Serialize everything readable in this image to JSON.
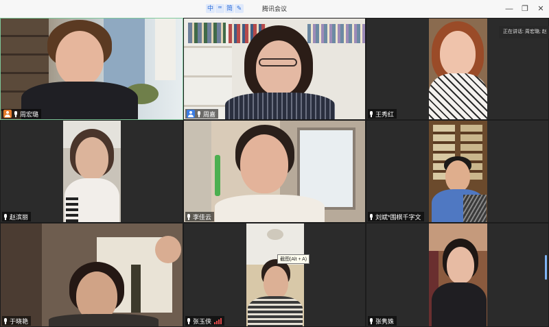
{
  "window": {
    "title": "腾讯会议",
    "ime_indicators": [
      "中",
      "ꟹ",
      "简",
      "✎"
    ],
    "controls": [
      "minimize-icon",
      "restore-icon",
      "close-icon"
    ]
  },
  "speaking_banner": "正在讲话: 周宏璐; 赵",
  "screenshot_tooltip": "截图(Alt + A)",
  "participants": [
    {
      "name": "周宏璐",
      "icon": "host-icon",
      "mic": "mic-icon"
    },
    {
      "name": "周嘉",
      "icon": "cohost-icon",
      "mic": "mic-icon"
    },
    {
      "name": "王秀红",
      "mic": "mic-icon"
    },
    {
      "name": "赵滨丽",
      "mic": "mic-icon"
    },
    {
      "name": "李佳云",
      "mic": "mic-icon"
    },
    {
      "name": "刘斌*围棋千字文",
      "mic": "mic-icon"
    },
    {
      "name": "于晓艳",
      "mic": "mic-icon"
    },
    {
      "name": "张玉侠",
      "mic": "mic-icon",
      "signal": "signal-bars-icon"
    },
    {
      "name": "张隽姝",
      "mic": "mic-icon"
    }
  ],
  "colors": {
    "speaker_border": "#7ec79a",
    "host_badge": "#e57c2b",
    "cohost_badge": "#3c7de3",
    "tile_bg": "#2b2b2b"
  }
}
